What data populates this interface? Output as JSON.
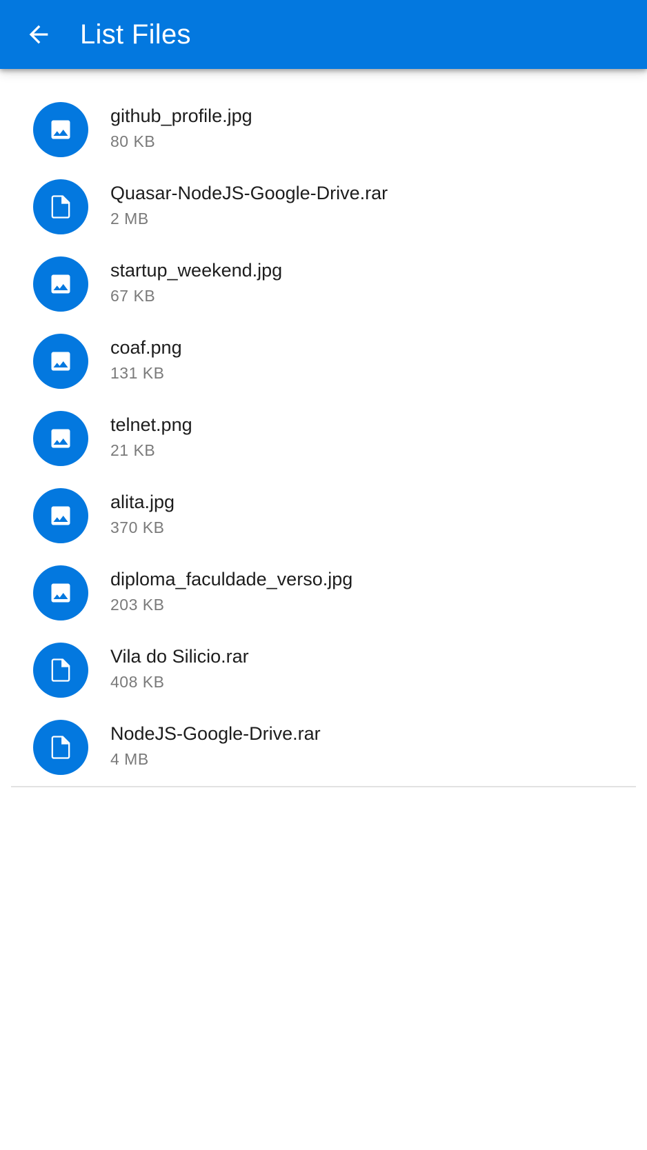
{
  "header": {
    "title": "List Files",
    "back_icon": "arrow-left-icon"
  },
  "theme": {
    "primary": "#0378df",
    "text_primary": "#1d1d1d",
    "text_secondary": "#7a7a7a"
  },
  "files": [
    {
      "name": "github_profile.jpg",
      "size": "80 KB",
      "icon": "image-icon"
    },
    {
      "name": "Quasar-NodeJS-Google-Drive.rar",
      "size": "2 MB",
      "icon": "file-icon"
    },
    {
      "name": "startup_weekend.jpg",
      "size": "67 KB",
      "icon": "image-icon"
    },
    {
      "name": "coaf.png",
      "size": "131 KB",
      "icon": "image-icon"
    },
    {
      "name": "telnet.png",
      "size": "21 KB",
      "icon": "image-icon"
    },
    {
      "name": "alita.jpg",
      "size": "370 KB",
      "icon": "image-icon"
    },
    {
      "name": "diploma_faculdade_verso.jpg",
      "size": "203 KB",
      "icon": "image-icon"
    },
    {
      "name": "Vila do Silicio.rar",
      "size": "408 KB",
      "icon": "file-icon"
    },
    {
      "name": "NodeJS-Google-Drive.rar",
      "size": "4 MB",
      "icon": "file-icon"
    }
  ]
}
